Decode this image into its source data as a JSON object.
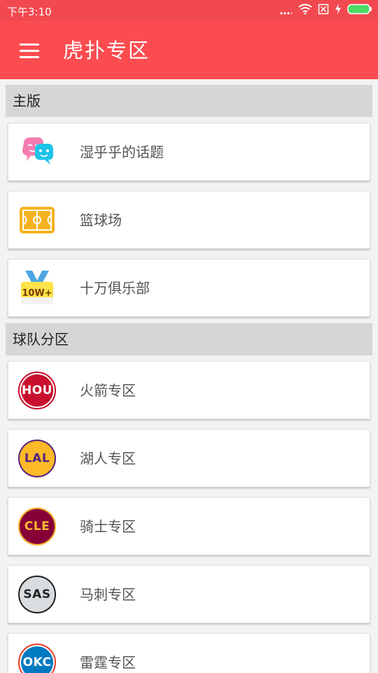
{
  "status_bar": {
    "time": "下午3:10",
    "icons": [
      "signal-dots-icon",
      "wifi-icon",
      "no-sim-icon",
      "charging-icon",
      "battery-icon"
    ],
    "color": "#f2484f"
  },
  "app_bar": {
    "title": "虎扑专区",
    "menu_icon": "hamburger-menu-icon",
    "color": "#fc4c50"
  },
  "sections": [
    {
      "header": "主版",
      "items": [
        {
          "label": "湿乎乎的话题",
          "icon": "chat-bubbles-icon"
        },
        {
          "label": "篮球场",
          "icon": "basketball-court-icon"
        },
        {
          "label": "十万俱乐部",
          "icon": "10w-medal-icon",
          "icon_text": "10W+"
        }
      ]
    },
    {
      "header": "球队分区",
      "items": [
        {
          "label": "火箭专区",
          "icon": "hou-team-logo",
          "logo_text": "HOU",
          "logo_bg": "#c8102e",
          "logo_fg": "#ffffff",
          "logo_ring": "#ffffff"
        },
        {
          "label": "湖人专区",
          "icon": "lal-team-logo",
          "logo_text": "LAL",
          "logo_bg": "#fdb927",
          "logo_fg": "#552583",
          "logo_ring": "#552583"
        },
        {
          "label": "骑士专区",
          "icon": "cle-team-logo",
          "logo_text": "CLE",
          "logo_bg": "#860038",
          "logo_fg": "#fdbb30",
          "logo_ring": "#fdbb30"
        },
        {
          "label": "马刺专区",
          "icon": "sas-team-logo",
          "logo_text": "SAS",
          "logo_bg": "#d9dde0",
          "logo_fg": "#222222",
          "logo_ring": "#222222"
        },
        {
          "label": "雷霆专区",
          "icon": "okc-team-logo",
          "logo_text": "OKC",
          "logo_bg": "#007ac1",
          "logo_fg": "#ffffff",
          "logo_ring": "#ef3b24"
        }
      ]
    }
  ]
}
